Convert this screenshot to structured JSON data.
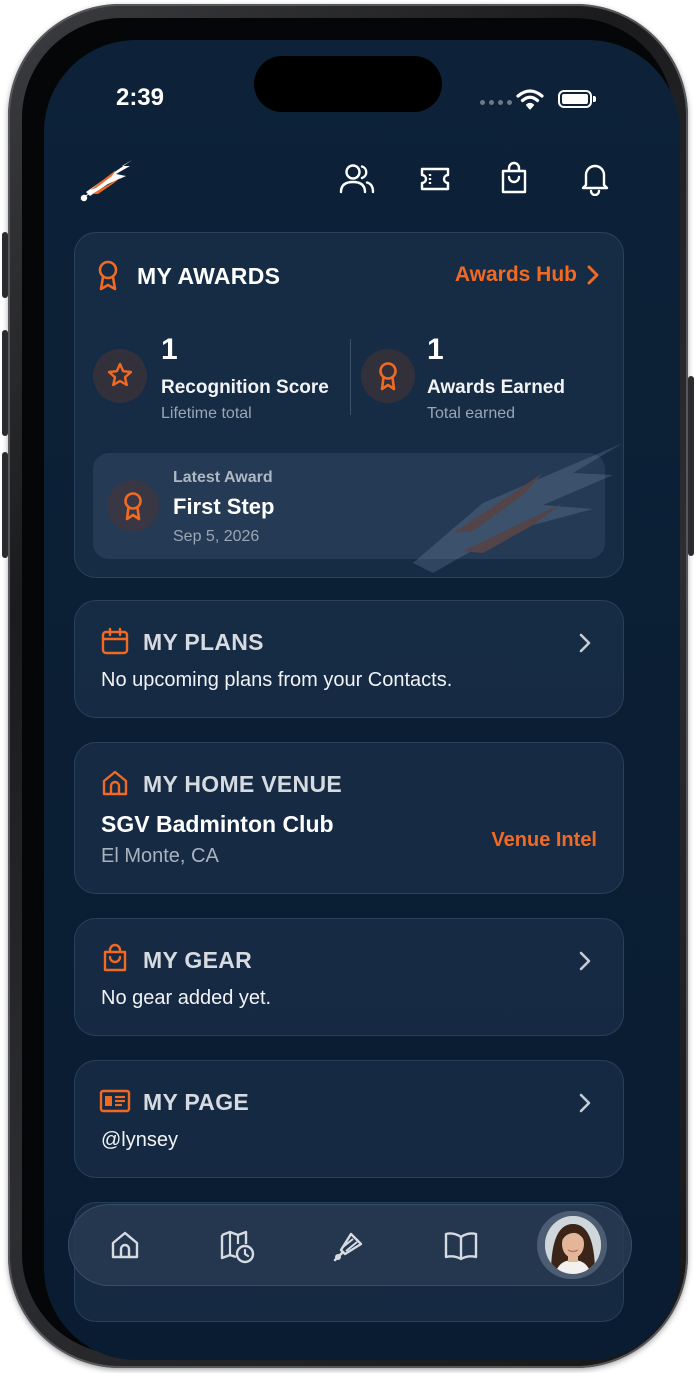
{
  "status_bar": {
    "time": "2:39"
  },
  "header": {
    "logo": "badminton-wing-logo",
    "icons": [
      "people-icon",
      "ticket-icon",
      "shopping-bag-icon",
      "bell-icon"
    ]
  },
  "awards": {
    "title": "MY AWARDS",
    "hub_link": "Awards Hub",
    "recognition": {
      "value": "1",
      "label": "Recognition Score",
      "sub": "Lifetime total"
    },
    "earned": {
      "value": "1",
      "label": "Awards Earned",
      "sub": "Total earned"
    },
    "latest": {
      "caption": "Latest Award",
      "name": "First Step",
      "date": "Sep 5, 2026"
    }
  },
  "plans": {
    "title": "MY PLANS",
    "text": "No upcoming plans from your Contacts."
  },
  "venue": {
    "title": "MY HOME VENUE",
    "name": "SGV Badminton Club",
    "location": "El Monte, CA",
    "link": "Venue Intel"
  },
  "gear": {
    "title": "MY GEAR",
    "text": "No gear added yet."
  },
  "page": {
    "title": "MY PAGE",
    "handle": "@lynsey"
  },
  "tabbar": {
    "tabs": [
      "home-icon",
      "map-clock-icon",
      "shuttlecock-icon",
      "book-icon",
      "profile-avatar"
    ]
  },
  "colors": {
    "accent": "#f06a23",
    "background": "#0b1f35",
    "card": "#1a3149"
  }
}
